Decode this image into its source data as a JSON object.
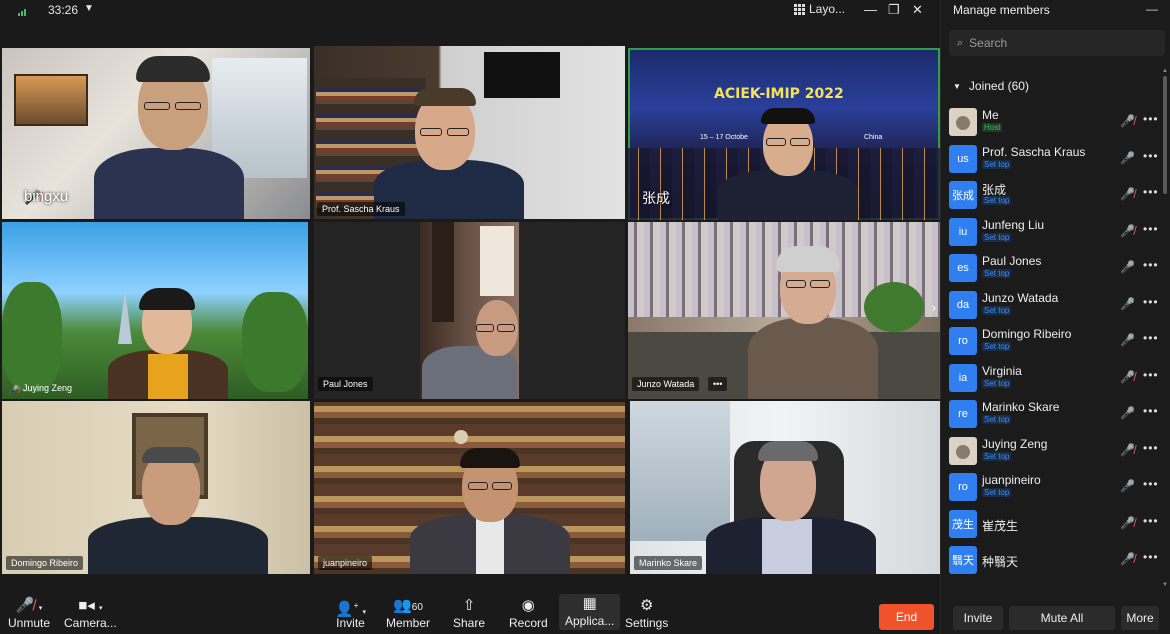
{
  "topbar": {
    "timer": "33:26",
    "layout_label": "Layo...",
    "minimize_icon": "minimize-icon",
    "restore_icon": "restore-icon",
    "close_icon": "close-icon"
  },
  "tiles": [
    {
      "name": "bingxu",
      "mic": "muted"
    },
    {
      "name": "Prof. Sascha Kraus"
    },
    {
      "name": "张成",
      "banner_title": "ACIEK-IMIP 2022",
      "banner_sub": "15 – 17 Octobe",
      "banner_city": "China"
    },
    {
      "name": "Juying Zeng",
      "mic": "muted"
    },
    {
      "name": "Paul Jones"
    },
    {
      "name": "Junzo Watada",
      "more": "•••"
    },
    {
      "name": "Domingo Ribeiro"
    },
    {
      "name": "juanpineiro"
    },
    {
      "name": "Marinko Skare"
    }
  ],
  "panel": {
    "title": "Manage members",
    "search_placeholder": "Search",
    "joined_label": "Joined (60)",
    "members": [
      {
        "avatar": "photo",
        "name": "Me",
        "tag": "Host",
        "tag_type": "host",
        "mic": "off"
      },
      {
        "avatar": "us",
        "name": "Prof. Sascha Kraus",
        "tag": "Set top",
        "tag_type": "settop",
        "mic": "on"
      },
      {
        "avatar": "张成",
        "name": "张成",
        "tag": "Set top",
        "tag_type": "settop",
        "mic": "off"
      },
      {
        "avatar": "iu",
        "name": "Junfeng Liu",
        "tag": "Set top",
        "tag_type": "settop",
        "mic": "off"
      },
      {
        "avatar": "es",
        "name": "Paul Jones",
        "tag": "Set top",
        "tag_type": "settop",
        "mic": "on"
      },
      {
        "avatar": "da",
        "name": "Junzo Watada",
        "tag": "Set top",
        "tag_type": "settop",
        "mic": "on"
      },
      {
        "avatar": "ro",
        "name": "Domingo Ribeiro",
        "tag": "Set top",
        "tag_type": "settop",
        "mic": "on"
      },
      {
        "avatar": "ia",
        "name": "Virginia",
        "tag": "Set top",
        "tag_type": "settop",
        "mic": "off"
      },
      {
        "avatar": "re",
        "name": "Marinko Skare",
        "tag": "Set top",
        "tag_type": "settop",
        "mic": "on"
      },
      {
        "avatar": "photo",
        "name": "Juying Zeng",
        "tag": "Set top",
        "tag_type": "settop",
        "mic": "off"
      },
      {
        "avatar": "ro",
        "name": "juanpineiro",
        "tag": "Set top",
        "tag_type": "settop",
        "mic": "on"
      },
      {
        "avatar": "茂生",
        "name": "崔茂生",
        "tag": "",
        "tag_type": "",
        "mic": "off"
      },
      {
        "avatar": "翳天",
        "name": "种翳天",
        "tag": "",
        "tag_type": "",
        "mic": "off"
      }
    ],
    "invite_label": "Invite",
    "mute_all_label": "Mute All",
    "more_label": "More"
  },
  "toolbar": {
    "unmute": "Unmute",
    "camera": "Camera...",
    "invite": "Invite",
    "member": "Member",
    "member_count": "60",
    "share": "Share",
    "record": "Record",
    "apps": "Applica...",
    "settings": "Settings",
    "end": "End"
  },
  "colors": {
    "accent_blue": "#2f7ff0",
    "end_red": "#f0522c",
    "active_green": "#2f9e44",
    "muted_red": "#ff5b5b"
  }
}
